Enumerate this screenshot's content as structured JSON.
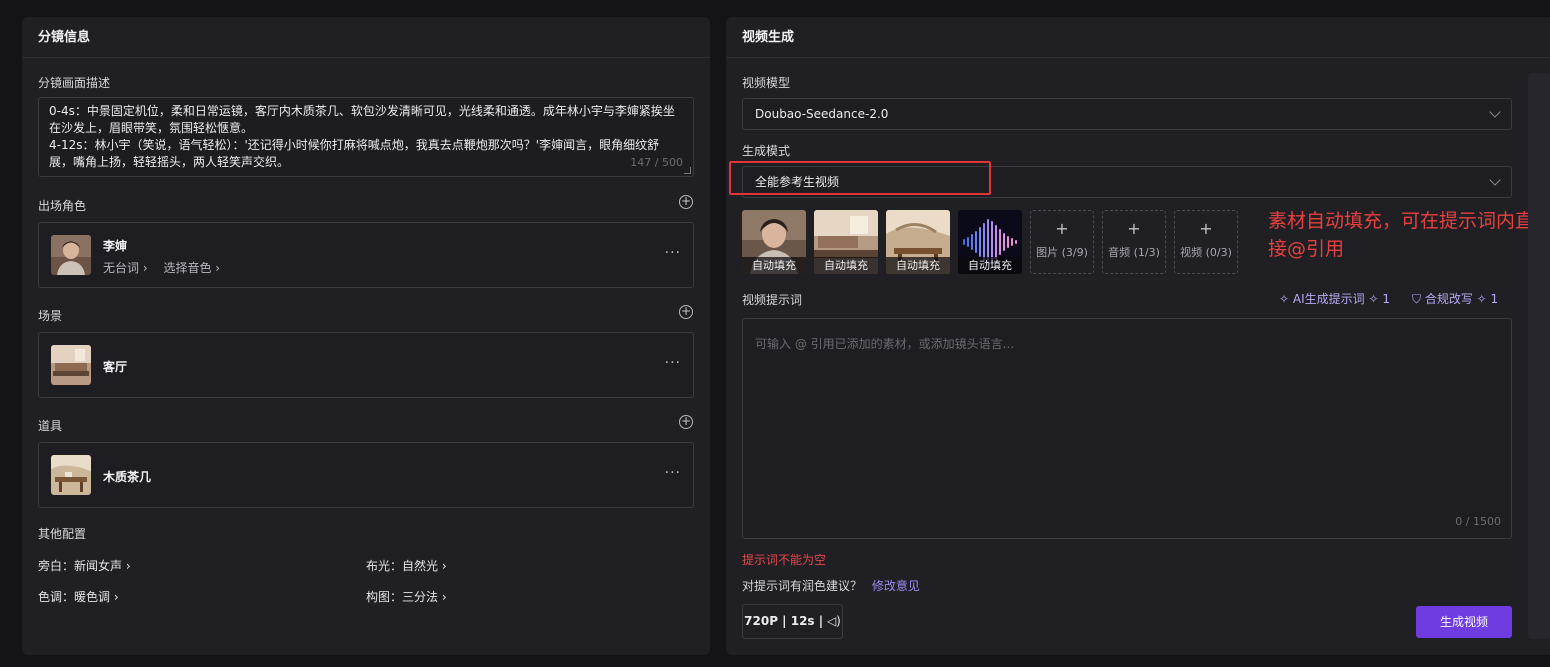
{
  "left": {
    "title": "分镜信息",
    "desc_label": "分镜画面描述",
    "desc_text": "0-4s：中景固定机位，柔和日常运镜，客厅内木质茶几、软包沙发清晰可见，光线柔和通透。成年林小宇与李婶紧挨坐在沙发上，眉眼带笑，氛围轻松惬意。\n4-12s：林小宇（笑说，语气轻松）：'还记得小时候你打麻将喊点炮，我真去点鞭炮那次吗？'李婶闻言，眼角细纹舒展，嘴角上扬，轻轻摇头，两人轻笑声交织。",
    "desc_count": "147 / 500",
    "characters_label": "出场角色",
    "character": {
      "name": "李婶",
      "line": "无台词",
      "voice": "选择音色"
    },
    "scene_label": "场景",
    "scene": {
      "name": "客厅"
    },
    "props_label": "道具",
    "prop": {
      "name": "木质茶几"
    },
    "other_label": "其他配置",
    "config": {
      "narration": "旁白：新闻女声",
      "lighting": "布光：自然光",
      "tone": "色调：暖色调",
      "composition": "构图：三分法"
    },
    "more": "···"
  },
  "right": {
    "title": "视频生成",
    "model_label": "视频模型",
    "model_value": "Doubao-Seedance-2.0",
    "mode_label": "生成模式",
    "mode_value": "全能参考生视频",
    "assets": [
      {
        "label": "自动填充",
        "kind": "portrait"
      },
      {
        "label": "自动填充",
        "kind": "living-room"
      },
      {
        "label": "自动填充",
        "kind": "tea-table"
      },
      {
        "label": "自动填充",
        "kind": "audio-wave"
      }
    ],
    "add_slots": [
      {
        "plus": "+",
        "label": "图片 (3/9)"
      },
      {
        "plus": "+",
        "label": "音频 (1/3)"
      },
      {
        "plus": "+",
        "label": "视频 (0/3)"
      }
    ],
    "annotation": "素材自动填充，可在提示词内直接@引用",
    "prompt_label": "视频提示词",
    "ai_prompt": "AI生成提示词",
    "ai_prompt_cost": "1",
    "compliance": "合规改写",
    "compliance_cost": "1",
    "prompt_placeholder": "可输入 @ 引用已添加的素材，或添加镜头语言...",
    "prompt_count": "0 / 1500",
    "error": "提示词不能为空",
    "suggest_q": "对提示词有润色建议？",
    "suggest_link": "修改意见",
    "quality": "720P | 12s |",
    "generate": "生成视频"
  },
  "colors": {
    "accent": "#6e3ce0",
    "error": "#e5484d",
    "annotation": "#e8403f",
    "highlight": "#e0353a"
  }
}
